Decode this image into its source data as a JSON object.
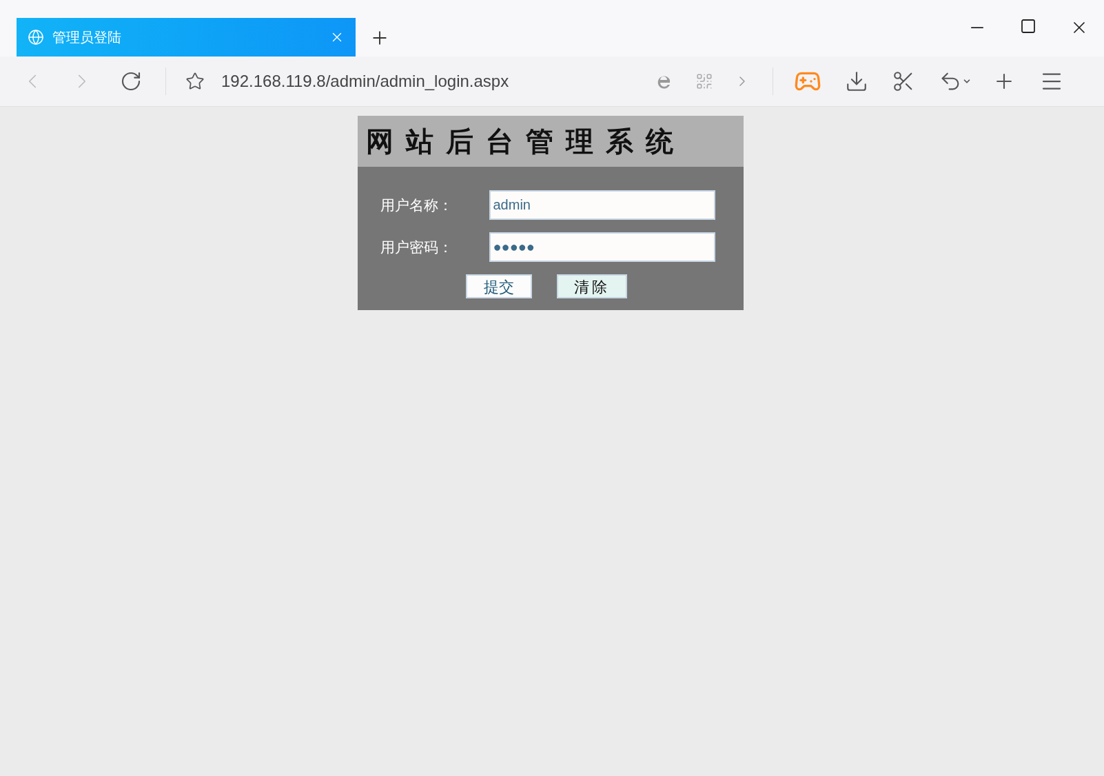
{
  "browser": {
    "tabs": [
      {
        "title": "管理员登陆",
        "selected": true
      }
    ],
    "address": "192.168.119.8/admin/admin_login.aspx"
  },
  "login": {
    "title": "网站后台管理系统",
    "fields": [
      {
        "label": "用户名称：",
        "value": "admin"
      },
      {
        "label": "用户密码：",
        "value": "●●●●●"
      }
    ],
    "buttons": [
      "提交",
      "清除"
    ]
  }
}
